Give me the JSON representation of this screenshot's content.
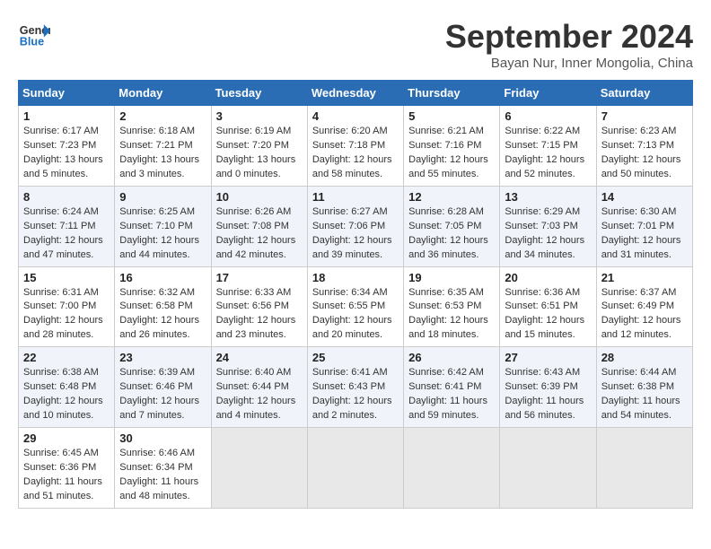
{
  "header": {
    "logo_line1": "General",
    "logo_line2": "Blue",
    "month": "September 2024",
    "location": "Bayan Nur, Inner Mongolia, China"
  },
  "weekdays": [
    "Sunday",
    "Monday",
    "Tuesday",
    "Wednesday",
    "Thursday",
    "Friday",
    "Saturday"
  ],
  "weeks": [
    [
      {
        "day": "1",
        "sunrise": "6:17 AM",
        "sunset": "7:23 PM",
        "daylight": "13 hours and 5 minutes."
      },
      {
        "day": "2",
        "sunrise": "6:18 AM",
        "sunset": "7:21 PM",
        "daylight": "13 hours and 3 minutes."
      },
      {
        "day": "3",
        "sunrise": "6:19 AM",
        "sunset": "7:20 PM",
        "daylight": "13 hours and 0 minutes."
      },
      {
        "day": "4",
        "sunrise": "6:20 AM",
        "sunset": "7:18 PM",
        "daylight": "12 hours and 58 minutes."
      },
      {
        "day": "5",
        "sunrise": "6:21 AM",
        "sunset": "7:16 PM",
        "daylight": "12 hours and 55 minutes."
      },
      {
        "day": "6",
        "sunrise": "6:22 AM",
        "sunset": "7:15 PM",
        "daylight": "12 hours and 52 minutes."
      },
      {
        "day": "7",
        "sunrise": "6:23 AM",
        "sunset": "7:13 PM",
        "daylight": "12 hours and 50 minutes."
      }
    ],
    [
      {
        "day": "8",
        "sunrise": "6:24 AM",
        "sunset": "7:11 PM",
        "daylight": "12 hours and 47 minutes."
      },
      {
        "day": "9",
        "sunrise": "6:25 AM",
        "sunset": "7:10 PM",
        "daylight": "12 hours and 44 minutes."
      },
      {
        "day": "10",
        "sunrise": "6:26 AM",
        "sunset": "7:08 PM",
        "daylight": "12 hours and 42 minutes."
      },
      {
        "day": "11",
        "sunrise": "6:27 AM",
        "sunset": "7:06 PM",
        "daylight": "12 hours and 39 minutes."
      },
      {
        "day": "12",
        "sunrise": "6:28 AM",
        "sunset": "7:05 PM",
        "daylight": "12 hours and 36 minutes."
      },
      {
        "day": "13",
        "sunrise": "6:29 AM",
        "sunset": "7:03 PM",
        "daylight": "12 hours and 34 minutes."
      },
      {
        "day": "14",
        "sunrise": "6:30 AM",
        "sunset": "7:01 PM",
        "daylight": "12 hours and 31 minutes."
      }
    ],
    [
      {
        "day": "15",
        "sunrise": "6:31 AM",
        "sunset": "7:00 PM",
        "daylight": "12 hours and 28 minutes."
      },
      {
        "day": "16",
        "sunrise": "6:32 AM",
        "sunset": "6:58 PM",
        "daylight": "12 hours and 26 minutes."
      },
      {
        "day": "17",
        "sunrise": "6:33 AM",
        "sunset": "6:56 PM",
        "daylight": "12 hours and 23 minutes."
      },
      {
        "day": "18",
        "sunrise": "6:34 AM",
        "sunset": "6:55 PM",
        "daylight": "12 hours and 20 minutes."
      },
      {
        "day": "19",
        "sunrise": "6:35 AM",
        "sunset": "6:53 PM",
        "daylight": "12 hours and 18 minutes."
      },
      {
        "day": "20",
        "sunrise": "6:36 AM",
        "sunset": "6:51 PM",
        "daylight": "12 hours and 15 minutes."
      },
      {
        "day": "21",
        "sunrise": "6:37 AM",
        "sunset": "6:49 PM",
        "daylight": "12 hours and 12 minutes."
      }
    ],
    [
      {
        "day": "22",
        "sunrise": "6:38 AM",
        "sunset": "6:48 PM",
        "daylight": "12 hours and 10 minutes."
      },
      {
        "day": "23",
        "sunrise": "6:39 AM",
        "sunset": "6:46 PM",
        "daylight": "12 hours and 7 minutes."
      },
      {
        "day": "24",
        "sunrise": "6:40 AM",
        "sunset": "6:44 PM",
        "daylight": "12 hours and 4 minutes."
      },
      {
        "day": "25",
        "sunrise": "6:41 AM",
        "sunset": "6:43 PM",
        "daylight": "12 hours and 2 minutes."
      },
      {
        "day": "26",
        "sunrise": "6:42 AM",
        "sunset": "6:41 PM",
        "daylight": "11 hours and 59 minutes."
      },
      {
        "day": "27",
        "sunrise": "6:43 AM",
        "sunset": "6:39 PM",
        "daylight": "11 hours and 56 minutes."
      },
      {
        "day": "28",
        "sunrise": "6:44 AM",
        "sunset": "6:38 PM",
        "daylight": "11 hours and 54 minutes."
      }
    ],
    [
      {
        "day": "29",
        "sunrise": "6:45 AM",
        "sunset": "6:36 PM",
        "daylight": "11 hours and 51 minutes."
      },
      {
        "day": "30",
        "sunrise": "6:46 AM",
        "sunset": "6:34 PM",
        "daylight": "11 hours and 48 minutes."
      },
      null,
      null,
      null,
      null,
      null
    ]
  ]
}
